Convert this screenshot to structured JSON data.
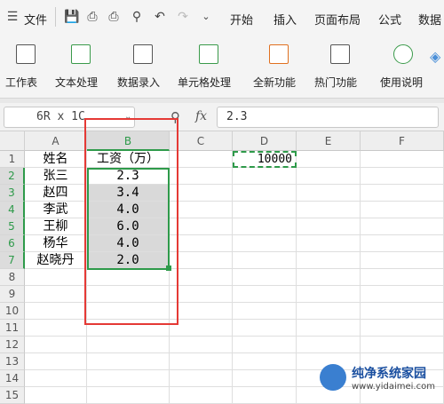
{
  "menu": {
    "file_label": "文件",
    "tabs": [
      "开始",
      "插入",
      "页面布局",
      "公式",
      "数据"
    ]
  },
  "ribbon": {
    "groups": [
      {
        "label": "工作表",
        "icon": "worksheet-icon"
      },
      {
        "label": "文本处理",
        "icon": "text-process-icon"
      },
      {
        "label": "数据录入",
        "icon": "data-entry-icon"
      },
      {
        "label": "单元格处理",
        "icon": "cell-process-icon"
      },
      {
        "label": "全新功能",
        "icon": "new-feature-icon"
      },
      {
        "label": "热门功能",
        "icon": "hot-feature-icon"
      },
      {
        "label": "使用说明",
        "icon": "help-icon"
      }
    ]
  },
  "formula_bar": {
    "name_box": "6R x 1C",
    "fx_label": "fx",
    "value": "2.3"
  },
  "sheet": {
    "columns": [
      "A",
      "B",
      "C",
      "D",
      "E",
      "F"
    ],
    "rows": [
      "1",
      "2",
      "3",
      "4",
      "5",
      "6",
      "7",
      "8",
      "9",
      "10",
      "11",
      "12",
      "13",
      "14",
      "15"
    ],
    "names": [
      "姓名",
      "张三",
      "赵四",
      "李武",
      "王柳",
      "杨华",
      "赵晓丹"
    ],
    "salaries": [
      "工资（万）",
      "2.3",
      "3.4",
      "4.0",
      "6.0",
      "4.0",
      "2.0"
    ],
    "d1_value": "10000"
  },
  "watermark": {
    "title": "纯净系统家园",
    "url": "www.yidaimei.com"
  },
  "colors": {
    "selection_green": "#2e9a4a",
    "annotation_red": "#e53935",
    "selected_fill": "#d9d9d9"
  }
}
